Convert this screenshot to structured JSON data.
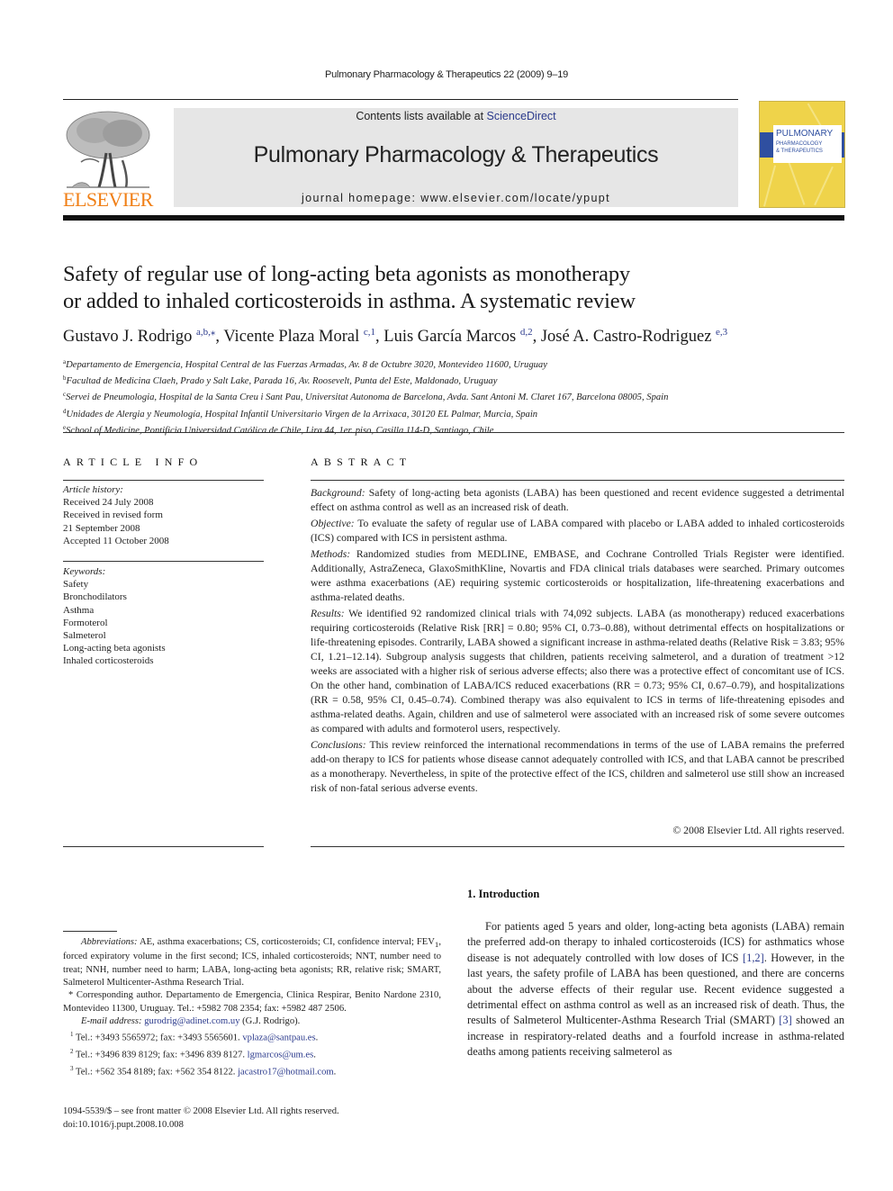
{
  "header": {
    "running_head": "Pulmonary Pharmacology & Therapeutics 22 (2009) 9–19",
    "contents_prefix": "Contents lists available at ",
    "contents_link": "ScienceDirect",
    "journal_title": "Pulmonary Pharmacology & Therapeutics",
    "homepage_prefix": "journal homepage: ",
    "homepage_url": "www.elsevier.com/locate/ypupt",
    "publisher_logo_text": "ELSEVIER",
    "cover": {
      "line1": "PULMONARY",
      "line2": "PHARMACOLOGY",
      "line3": "& THERAPEUTICS"
    },
    "colors": {
      "elsevier_orange": "#f07f16",
      "link_blue": "#2b3a8c",
      "banner_gray": "#e6e6e6",
      "cover_yellow": "#efd34a",
      "cover_blue": "#2f4fa0"
    }
  },
  "article": {
    "title_line1": "Safety of regular use of long-acting beta agonists as monotherapy",
    "title_line2": "or added to inhaled corticosteroids in asthma. A systematic review",
    "authors": [
      {
        "name": "Gustavo J. Rodrigo",
        "marks": "a,b,⁎",
        "sep": ", "
      },
      {
        "name": "Vicente Plaza Moral",
        "marks": "c,1",
        "sep": ", "
      },
      {
        "name": "Luis García Marcos",
        "marks": "d,2",
        "sep": ", "
      },
      {
        "name": "José A. Castro-Rodriguez",
        "marks": "e,3",
        "sep": ""
      }
    ],
    "affiliations": [
      {
        "mark": "a",
        "text": "Departamento de Emergencia, Hospital Central de las Fuerzas Armadas, Av. 8 de Octubre 3020, Montevideo 11600, Uruguay"
      },
      {
        "mark": "b",
        "text": "Facultad de Medicina Claeh, Prado y Salt Lake, Parada 16, Av. Roosevelt, Punta del Este, Maldonado, Uruguay"
      },
      {
        "mark": "c",
        "text": "Servei de Pneumologia, Hospital de la Santa Creu i Sant Pau, Universitat Autonoma de Barcelona, Avda. Sant Antoni M. Claret 167, Barcelona 08005, Spain"
      },
      {
        "mark": "d",
        "text": "Unidades de Alergia y Neumología, Hospital Infantil Universitario Virgen de la Arrixaca, 30120 EL Palmar, Murcia, Spain"
      },
      {
        "mark": "e",
        "text": "School of Medicine, Pontificia Universidad Católica de Chile, Lira 44, 1er. piso, Casilla 114-D, Santiago, Chile"
      }
    ]
  },
  "article_info": {
    "label": "ARTICLE INFO",
    "history_heading": "Article history:",
    "history": [
      "Received 24 July 2008",
      "Received in revised form",
      "21 September 2008",
      "Accepted 11 October 2008"
    ],
    "keywords_heading": "Keywords:",
    "keywords": [
      "Safety",
      "Bronchodilators",
      "Asthma",
      "Formoterol",
      "Salmeterol",
      "Long-acting beta agonists",
      "Inhaled corticosteroids"
    ]
  },
  "abstract": {
    "label": "ABSTRACT",
    "sections": [
      {
        "heading": "Background:",
        "text": " Safety of long-acting beta agonists (LABA) has been questioned and recent evidence suggested a detrimental effect on asthma control as well as an increased risk of death."
      },
      {
        "heading": "Objective:",
        "text": " To evaluate the safety of regular use of LABA compared with placebo or LABA added to inhaled corticosteroids (ICS) compared with ICS in persistent asthma."
      },
      {
        "heading": "Methods:",
        "text": " Randomized studies from MEDLINE, EMBASE, and Cochrane Controlled Trials Register were identified. Additionally, AstraZeneca, GlaxoSmithKline, Novartis and FDA clinical trials databases were searched. Primary outcomes were asthma exacerbations (AE) requiring systemic corticosteroids or hospitalization, life-threatening exacerbations and asthma-related deaths."
      },
      {
        "heading": "Results:",
        "text": " We identified 92 randomized clinical trials with 74,092 subjects. LABA (as monotherapy) reduced exacerbations requiring corticosteroids (Relative Risk [RR] = 0.80; 95% CI, 0.73–0.88), without detrimental effects on hospitalizations or life-threatening episodes. Contrarily, LABA showed a significant increase in asthma-related deaths (Relative Risk = 3.83; 95% CI, 1.21–12.14). Subgroup analysis suggests that children, patients receiving salmeterol, and a duration of treatment >12 weeks are associated with a higher risk of serious adverse effects; also there was a protective effect of concomitant use of ICS. On the other hand, combination of LABA/ICS reduced exacerbations (RR = 0.73; 95% CI, 0.67–0.79), and hospitalizations (RR = 0.58, 95% CI, 0.45–0.74). Combined therapy was also equivalent to ICS in terms of life-threatening episodes and asthma-related deaths. Again, children and use of salmeterol were associated with an increased risk of some severe outcomes as compared with adults and formoterol users, respectively."
      },
      {
        "heading": "Conclusions:",
        "text": " This review reinforced the international recommendations in terms of the use of LABA remains the preferred add-on therapy to ICS for patients whose disease cannot adequately controlled with ICS, and that LABA cannot be prescribed as a monotherapy. Nevertheless, in spite of the protective effect of the ICS, children and salmeterol use still show an increased risk of non-fatal serious adverse events."
      }
    ],
    "copyright": "© 2008 Elsevier Ltd. All rights reserved."
  },
  "footnotes": {
    "abbreviations_heading": "Abbreviations:",
    "abbreviations_text_a": " AE, asthma exacerbations; CS, corticosteroids; CI, confidence interval; FEV",
    "abbreviations_sub": "1",
    "abbreviations_text_b": ", forced expiratory volume in the first second; ICS, inhaled corticosteroids; NNT, number need to treat; NNH, number need to harm; LABA, long-acting beta agonists; RR, relative risk; SMART, Salmeterol Multicenter-Asthma Research Trial.",
    "corresponding_mark": "*",
    "corresponding_text": " Corresponding author. Departamento de Emergencia, Clinica Respirar, Benito Nardone 2310, Montevideo 11300, Uruguay. Tel.: +5982 708 2354; fax: +5982 487 2506.",
    "email_label": "E-mail address:",
    "email": "gurodrig@adinet.com.uy",
    "email_owner": " (G.J. Rodrigo).",
    "contacts": [
      {
        "mark": "1",
        "text": " Tel.: +3493 5565972; fax: +3493 5565601. ",
        "email": "vplaza@santpau.es",
        "end": "."
      },
      {
        "mark": "2",
        "text": " Tel.: +3496 839 8129; fax: +3496 839 8127. ",
        "email": "lgmarcos@um.es",
        "end": "."
      },
      {
        "mark": "3",
        "text": " Tel.: +562 354 8189; fax: +562 354 8122. ",
        "email": "jacastro17@hotmail.com",
        "end": "."
      }
    ],
    "issn": "1094-5539/$ – see front matter © 2008 Elsevier Ltd. All rights reserved.",
    "doi": "doi:10.1016/j.pupt.2008.10.008"
  },
  "introduction": {
    "heading": "1.  Introduction",
    "text_a": "For patients aged 5 years and older, long-acting beta agonists (LABA) remain the preferred add-on therapy to inhaled corticosteroids (ICS) for asthmatics whose disease is not adequately controlled with low doses of ICS ",
    "ref_a": "[1,2]",
    "text_b": ". However, in the last years, the safety profile of LABA has been questioned, and there are concerns about the adverse effects of their regular use. Recent evidence suggested a detrimental effect on asthma control as well as an increased risk of death. Thus, the results of Salmeterol Multicenter-Asthma Research Trial (SMART) ",
    "ref_b": "[3]",
    "text_c": " showed an increase in respiratory-related deaths and a fourfold increase in asthma-related deaths among patients receiving salmeterol as"
  }
}
